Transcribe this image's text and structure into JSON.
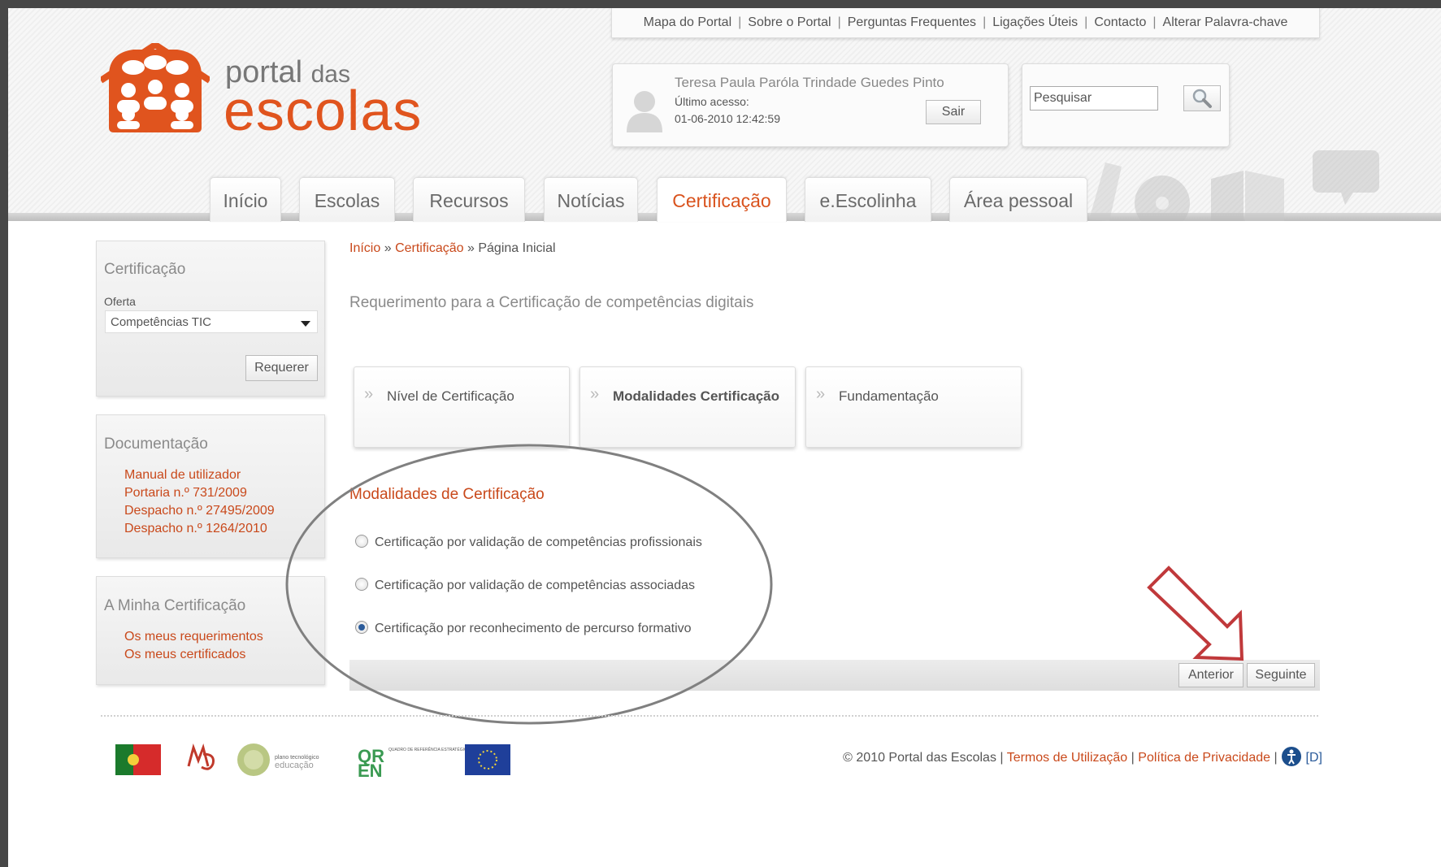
{
  "toplinks": [
    "Mapa do Portal",
    "Sobre o Portal",
    "Perguntas Frequentes",
    "Ligações Úteis",
    "Contacto",
    "Alterar Palavra-chave"
  ],
  "logo": {
    "word1": "portal",
    "word2": "das",
    "word3": "escolas"
  },
  "user": {
    "name": "Teresa Paula Paróla Trindade Guedes Pinto",
    "last_access_label": "Último acesso:",
    "last_access_date": "01-06-2010 12:42:59",
    "logout_label": "Sair"
  },
  "search": {
    "placeholder": "Pesquisar"
  },
  "tabs": [
    {
      "label": "Início"
    },
    {
      "label": "Escolas"
    },
    {
      "label": "Recursos"
    },
    {
      "label": "Notícias"
    },
    {
      "label": "Certificação"
    },
    {
      "label": "e.Escolinha"
    },
    {
      "label": "Área pessoal"
    }
  ],
  "active_tab": "Certificação",
  "sidebar": {
    "certificacao": {
      "title": "Certificação",
      "oferta_label": "Oferta",
      "oferta_value": "Competências TIC",
      "button": "Requerer"
    },
    "documentacao": {
      "title": "Documentação",
      "links": [
        "Manual de utilizador",
        "Portaria n.º 731/2009",
        "Despacho n.º 27495/2009",
        "Despacho n.º 1264/2010"
      ]
    },
    "minha": {
      "title": "A Minha Certificação",
      "links": [
        "Os meus requerimentos",
        "Os meus certificados"
      ]
    }
  },
  "breadcrumb": {
    "item1": "Início",
    "sep": "»",
    "item2": "Certificação",
    "item3": "Página Inicial"
  },
  "page_title": "Requerimento para a Certificação de competências digitais",
  "steps": [
    {
      "label": "Nível de Certificação",
      "active": false
    },
    {
      "label": "Modalidades Certificação",
      "active": true
    },
    {
      "label": "Fundamentação",
      "active": false
    }
  ],
  "section_title": "Modalidades de Certificação",
  "options": [
    {
      "label": "Certificação por validação de competências profissionais",
      "checked": false
    },
    {
      "label": "Certificação por validação de competências associadas",
      "checked": false
    },
    {
      "label": "Certificação por reconhecimento de percurso formativo",
      "checked": true
    }
  ],
  "nav": {
    "previous": "Anterior",
    "next": "Seguinte"
  },
  "footer": {
    "copyright": "© 2010 Portal das Escolas",
    "terms": "Termos de Utilização",
    "privacy": "Política de Privacidade",
    "d": "[D]",
    "logo_pte_line1": "plano tecnológico",
    "logo_pte_line2": "educação",
    "logo_qren": "QUADRO DE REFERÊNCIA ESTRATÉGICO NACIONAL"
  },
  "colors": {
    "accent": "#d9531e",
    "link": "#c9491b"
  }
}
